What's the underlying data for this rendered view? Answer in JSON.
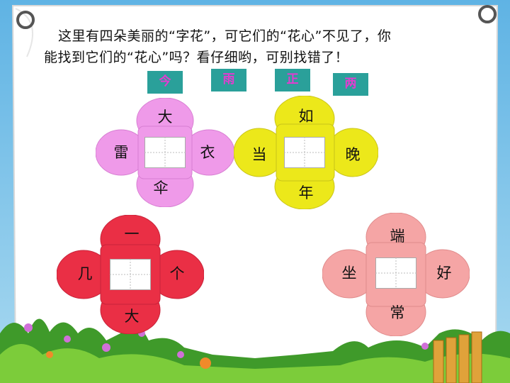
{
  "instruction": {
    "line1": "这里有四朵美丽的“字花”，可它们的“花心”不见了，你",
    "line2": "能找到它们的“花心”吗？看仔细哟，可别找错了！"
  },
  "answer_chips": [
    "今",
    "雨",
    "正",
    "两"
  ],
  "flowers": [
    {
      "color": "#ef9ae9",
      "top": "大",
      "left": "雷",
      "right": "衣",
      "bottom": "伞"
    },
    {
      "color": "#ece81a",
      "top": "如",
      "left": "当",
      "right": "晚",
      "bottom": "年"
    },
    {
      "color": "#ea2f45",
      "top": "一",
      "left": "几",
      "right": "个",
      "bottom": "大"
    },
    {
      "color": "#f5a5a5",
      "top": "端",
      "left": "坐",
      "right": "好",
      "bottom": "常"
    }
  ],
  "colors": {
    "sky": "#7fc1e6",
    "paper": "#ffffff",
    "chip_bg": "#2aa09a",
    "chip_text": "#e23cd0"
  }
}
